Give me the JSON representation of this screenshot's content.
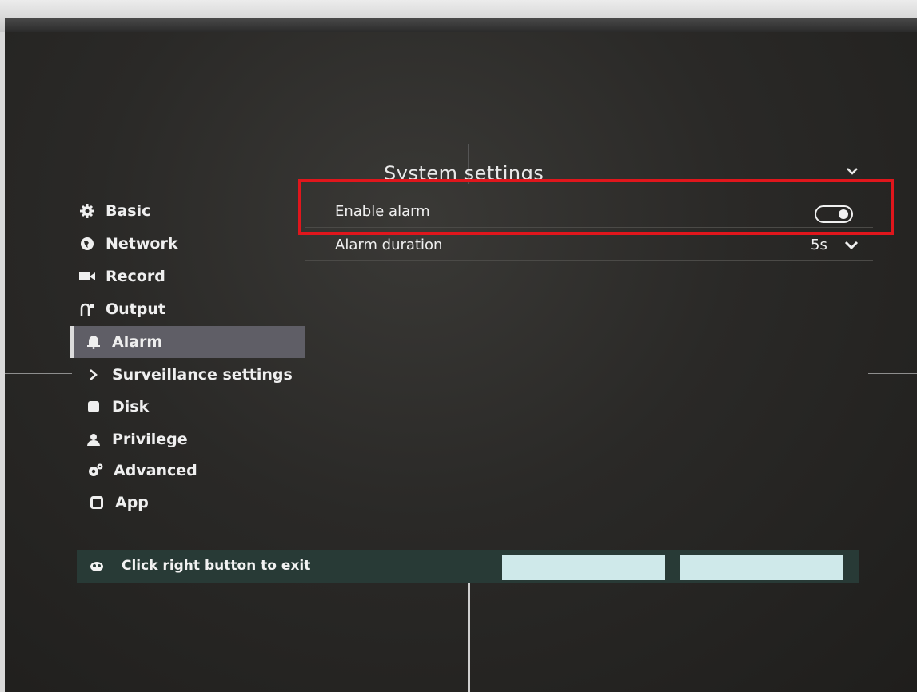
{
  "dialog": {
    "title": "System settings"
  },
  "sidebar": {
    "items": [
      {
        "label": "Basic",
        "icon": "gear-icon"
      },
      {
        "label": "Network",
        "icon": "globe-icon"
      },
      {
        "label": "Record",
        "icon": "video-camera-icon"
      },
      {
        "label": "Output",
        "icon": "output-icon"
      },
      {
        "label": "Alarm",
        "icon": "bell-icon",
        "active": true
      },
      {
        "label": "Surveillance settings",
        "icon": "chevron-right-icon"
      },
      {
        "label": "Disk",
        "icon": "disk-icon"
      },
      {
        "label": "Privilege",
        "icon": "user-icon"
      },
      {
        "label": "Advanced",
        "icon": "cogs-icon"
      },
      {
        "label": "App",
        "icon": "square-icon"
      }
    ]
  },
  "settings": {
    "enable_alarm": {
      "label": "Enable alarm",
      "value": true
    },
    "alarm_duration": {
      "label": "Alarm duration",
      "value": "5s"
    }
  },
  "bottombar": {
    "hint": "Click right button to exit",
    "ok_label": "",
    "cancel_label": ""
  },
  "colors": {
    "highlight": "#e0161c",
    "active_item": "#5f5e66",
    "bottombar": "#283a36",
    "button": "#cfe9ea"
  }
}
